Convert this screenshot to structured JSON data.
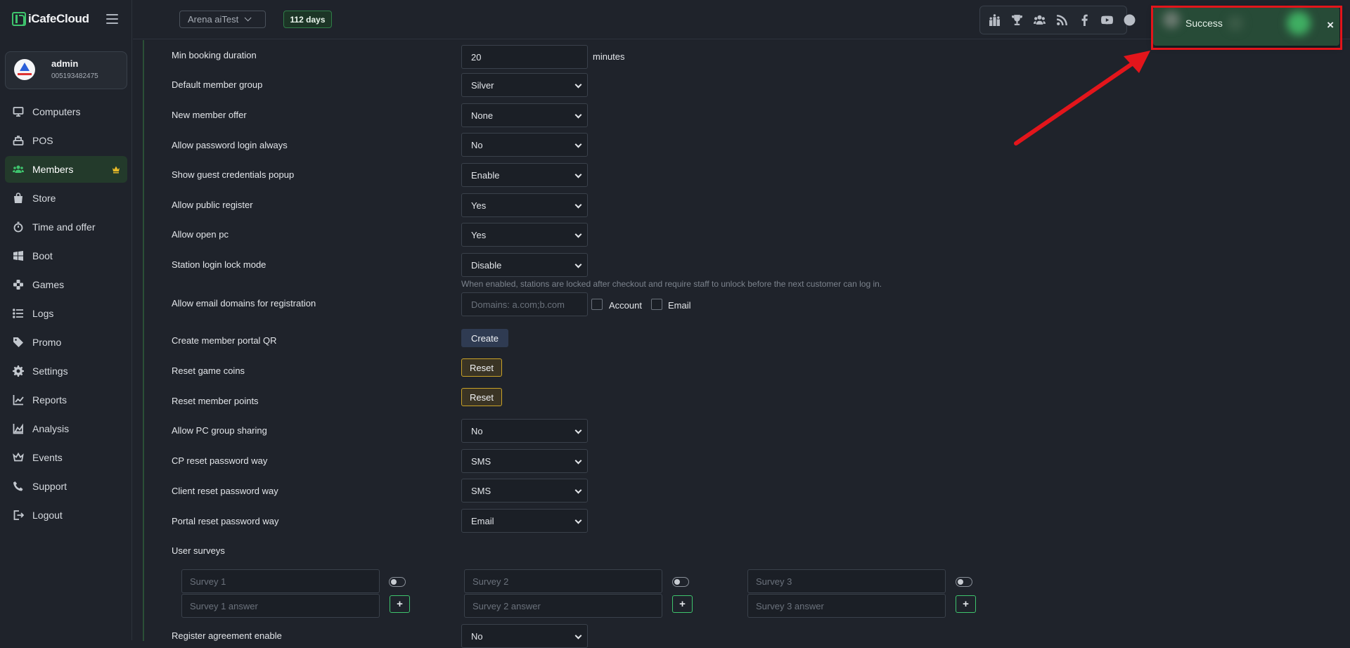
{
  "brand": {
    "name": "iCafeCloud"
  },
  "user": {
    "name": "admin",
    "id": "005193482475"
  },
  "nav": {
    "items": [
      {
        "label": "Computers"
      },
      {
        "label": "POS"
      },
      {
        "label": "Members"
      },
      {
        "label": "Store"
      },
      {
        "label": "Time and offer"
      },
      {
        "label": "Boot"
      },
      {
        "label": "Games"
      },
      {
        "label": "Logs"
      },
      {
        "label": "Promo"
      },
      {
        "label": "Settings"
      },
      {
        "label": "Reports"
      },
      {
        "label": "Analysis"
      },
      {
        "label": "Events"
      },
      {
        "label": "Support"
      },
      {
        "label": "Logout"
      }
    ],
    "active": "Members"
  },
  "topbar": {
    "site": "Arena aiTest",
    "days": "112 days"
  },
  "social_icons": [
    "ranking-icon",
    "trophy-icon",
    "users-icon",
    "rss-icon",
    "facebook-icon",
    "youtube-icon",
    "globe-icon"
  ],
  "toast": {
    "message": "Success",
    "close": "×"
  },
  "settings": {
    "min_booking": {
      "label": "Min booking duration",
      "value": "20",
      "unit": "minutes"
    },
    "default_member_group": {
      "label": "Default member group",
      "value": "Silver"
    },
    "new_member_offer": {
      "label": "New member offer",
      "value": "None"
    },
    "allow_password_login": {
      "label": "Allow password login always",
      "value": "No"
    },
    "show_guest_credentials": {
      "label": "Show guest credentials popup",
      "value": "Enable"
    },
    "allow_public_register": {
      "label": "Allow public register",
      "value": "Yes"
    },
    "allow_open_pc": {
      "label": "Allow open pc",
      "value": "Yes"
    },
    "station_login_lock": {
      "label": "Station login lock mode",
      "value": "Disable",
      "hint": "When enabled, stations are locked after checkout and require staff to unlock before the next customer can log in."
    },
    "email_domains": {
      "label": "Allow email domains for registration",
      "placeholder": "Domains: a.com;b.com",
      "check_account": "Account",
      "check_email": "Email"
    },
    "member_portal_qr": {
      "label": "Create member portal QR",
      "button": "Create"
    },
    "reset_game_coins": {
      "label": "Reset game coins",
      "button": "Reset"
    },
    "reset_member_points": {
      "label": "Reset member points",
      "button": "Reset"
    },
    "pc_group_sharing": {
      "label": "Allow PC group sharing",
      "value": "No"
    },
    "cp_reset_password": {
      "label": "CP reset password way",
      "value": "SMS"
    },
    "client_reset_password": {
      "label": "Client reset password way",
      "value": "SMS"
    },
    "portal_reset_password": {
      "label": "Portal reset password way",
      "value": "Email"
    },
    "user_surveys": {
      "label": "User surveys",
      "surveys": [
        {
          "question": "Survey 1",
          "answer": "Survey 1 answer"
        },
        {
          "question": "Survey 2",
          "answer": "Survey 2 answer"
        },
        {
          "question": "Survey 3",
          "answer": "Survey 3 answer"
        }
      ],
      "add": "+"
    },
    "register_agreement": {
      "label": "Register agreement enable",
      "value": "No"
    }
  },
  "colors": {
    "accent": "#3ec46d",
    "toast_bg": "#274b37",
    "annotation_red": "#e3151b",
    "reset_border": "#c9a227"
  }
}
